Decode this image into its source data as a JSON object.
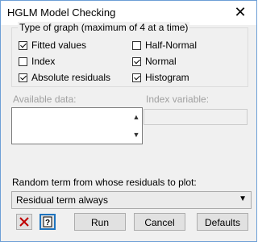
{
  "window": {
    "title": "HGLM Model Checking",
    "close_glyph": "✕"
  },
  "graph_group": {
    "legend": "Type of graph (maximum of 4 at a time)",
    "options": [
      {
        "label": "Fitted values",
        "checked": true
      },
      {
        "label": "Index",
        "checked": false
      },
      {
        "label": "Absolute residuals",
        "checked": true
      },
      {
        "label": "Half-Normal",
        "checked": false
      },
      {
        "label": "Normal",
        "checked": true
      },
      {
        "label": "Histogram",
        "checked": true
      }
    ]
  },
  "available_data": {
    "label": "Available data:"
  },
  "index_variable": {
    "label": "Index variable:"
  },
  "random_term": {
    "label": "Random term from whose residuals to plot:",
    "selected": "Residual term always"
  },
  "buttons": {
    "run": "Run",
    "cancel": "Cancel",
    "defaults": "Defaults"
  },
  "icons": {
    "clear": "close-red-x-icon",
    "help": "help-question-icon"
  }
}
